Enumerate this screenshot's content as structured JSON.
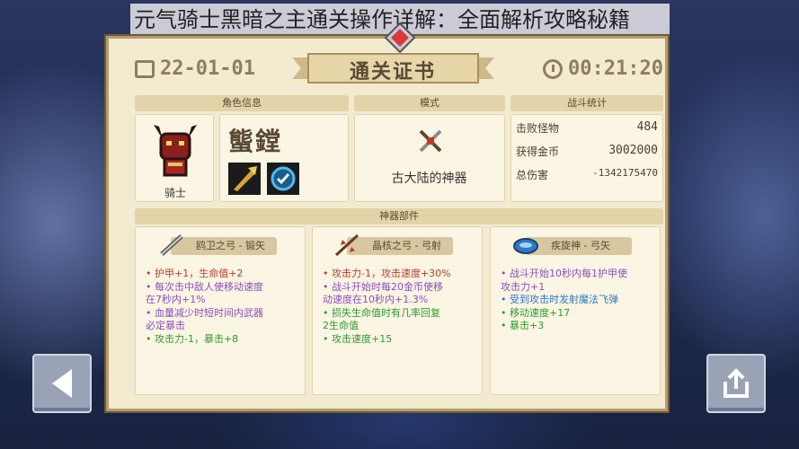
{
  "caption": "元气骑士黑暗之主通关操作详解：全面解析攻略秘籍",
  "header": {
    "date": "22-01-01",
    "title": "通关证书",
    "time": "00:21:20"
  },
  "sections": {
    "character": "角色信息",
    "mode": "模式",
    "stats": "战斗统计",
    "parts": "神器部件"
  },
  "character": {
    "name": "螚鏜",
    "class": "骑士"
  },
  "mode": {
    "label": "古大陆的神器"
  },
  "stats": [
    {
      "label": "击败怪物",
      "value": "484"
    },
    {
      "label": "获得金币",
      "value": "3002000"
    },
    {
      "label": "总伤害",
      "value": "-1342175470"
    }
  ],
  "items": [
    {
      "title": "鸥卫之弓 - 锻矢",
      "color": "#8a4fc2",
      "lines": [
        {
          "text": "• 护甲+1，生命值+2",
          "color": "#c0392b"
        },
        {
          "text": "• 每次击中敌人使移动速度\n在7秒内+1%",
          "color": "#8a4fc2"
        },
        {
          "text": "• 血量减少时短时间内武器\n必定暴击",
          "color": "#8a4fc2"
        },
        {
          "text": "• 攻击力-1，暴击+8",
          "color": "#2e9b2e"
        }
      ]
    },
    {
      "title": "晶核之弓 - 弓射",
      "color": "#8a4fc2",
      "lines": [
        {
          "text": "• 攻击力-1，攻击速度+30%",
          "color": "#c0392b"
        },
        {
          "text": "• 战斗开始时每20金币使移\n动速度在10秒内+1.3%",
          "color": "#8a4fc2"
        },
        {
          "text": "• 损失生命值时有几率回复\n2生命值",
          "color": "#2e9b2e"
        },
        {
          "text": "• 攻击速度+15",
          "color": "#2e9b2e"
        }
      ]
    },
    {
      "title": "疾旋神 - 弓矢",
      "color": "#2f78c4",
      "lines": [
        {
          "text": "• 战斗开始10秒内每1护甲使\n攻击力+1",
          "color": "#8a4fc2"
        },
        {
          "text": "• 受到攻击时发射魔法飞弹",
          "color": "#2f78c4"
        },
        {
          "text": "• 移动速度+17",
          "color": "#2e9b2e"
        },
        {
          "text": "• 暴击+3",
          "color": "#2e9b2e"
        }
      ]
    }
  ],
  "icons": {
    "back": "left-arrow-icon",
    "share": "share-icon"
  }
}
